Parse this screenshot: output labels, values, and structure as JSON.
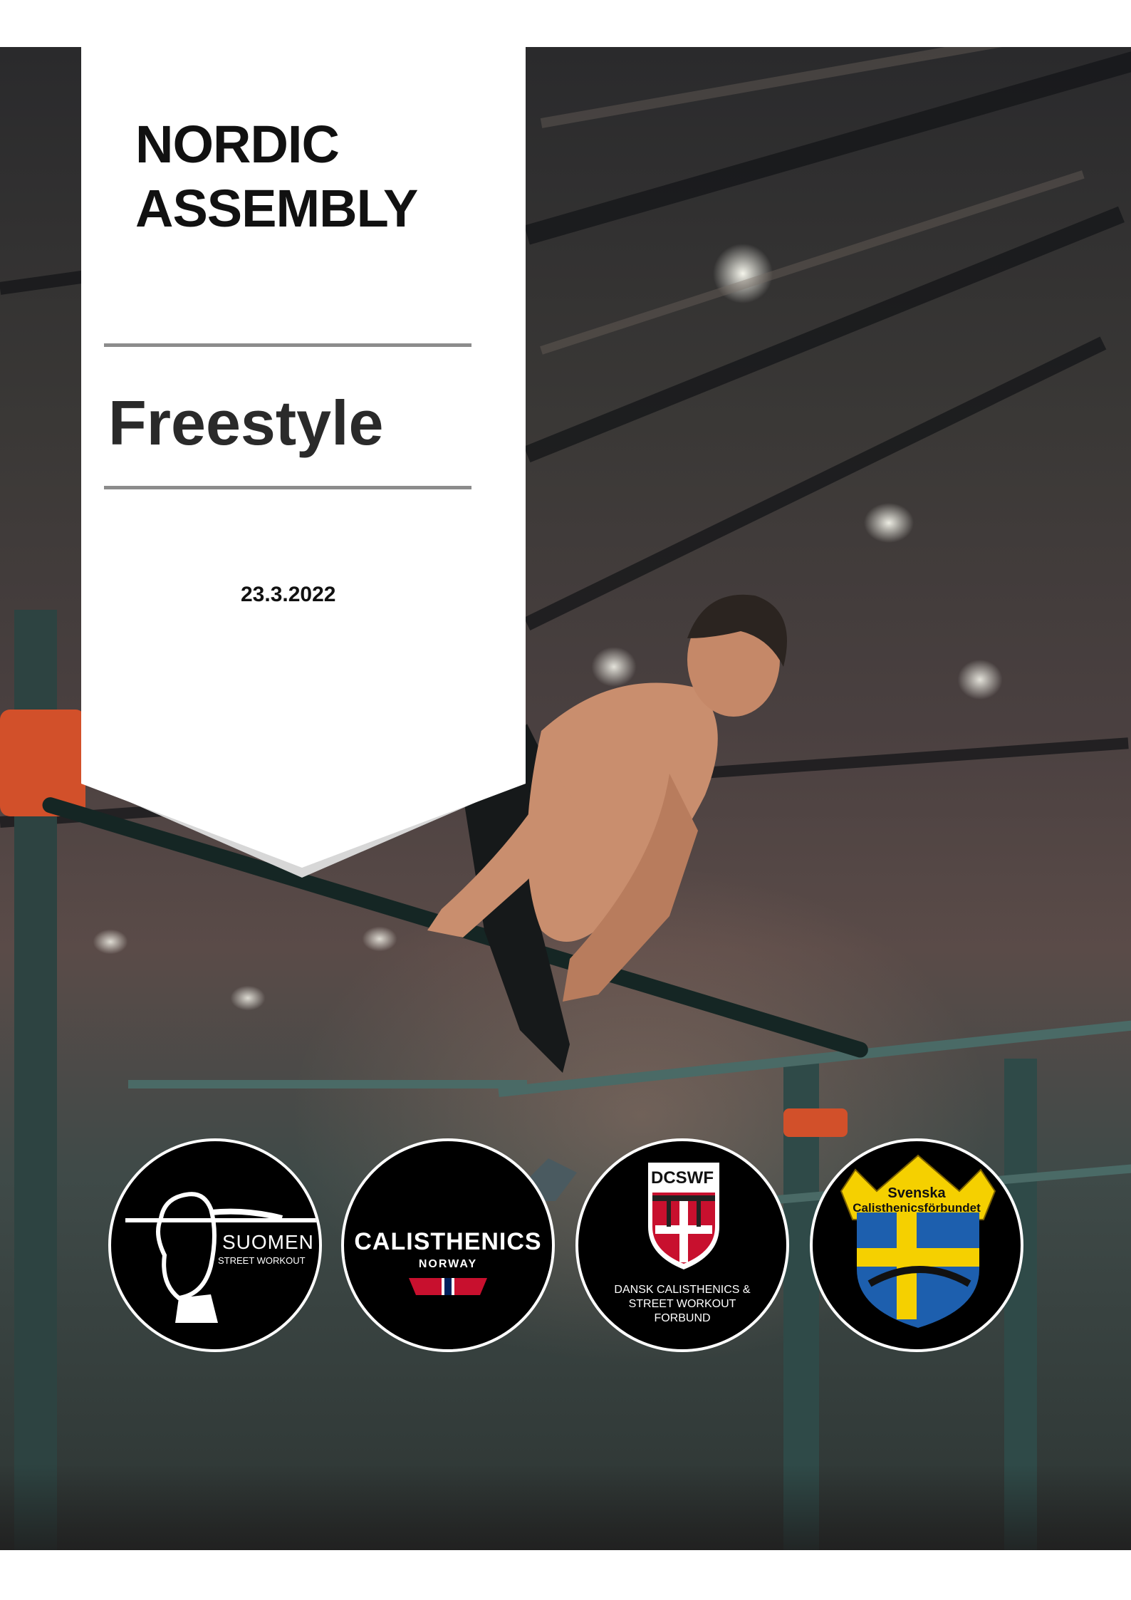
{
  "cover": {
    "title_line1": "NORDIC",
    "title_line2": "ASSEMBLY",
    "subtitle": "Freestyle",
    "date": "23.3.2022"
  },
  "logos": [
    {
      "name": "suomen-street-workout",
      "line1": "SUOMEN",
      "line2": "STREET WORKOUT"
    },
    {
      "name": "calisthenics-norway",
      "line1": "CALISTHENICS",
      "line2": "NORWAY"
    },
    {
      "name": "dcswf",
      "line1": "DCSWF",
      "line2": "DANSK CALISTHENICS &",
      "line3": "STREET WORKOUT",
      "line4": "FORBUND"
    },
    {
      "name": "svenska-calisthenicsforbundet",
      "line1": "Svenska",
      "line2": "Calisthenicsförbundet"
    }
  ],
  "colors": {
    "banner": "#ffffff",
    "banner_shadow": "#d7d7d7",
    "rule": "#8c8c8c",
    "logo_bg": "#000000",
    "norway_red": "#c8102e",
    "norway_blue": "#00205b",
    "danish_red": "#c8102e",
    "swedish_blue": "#1d5fae",
    "swedish_yellow": "#f5d000"
  }
}
